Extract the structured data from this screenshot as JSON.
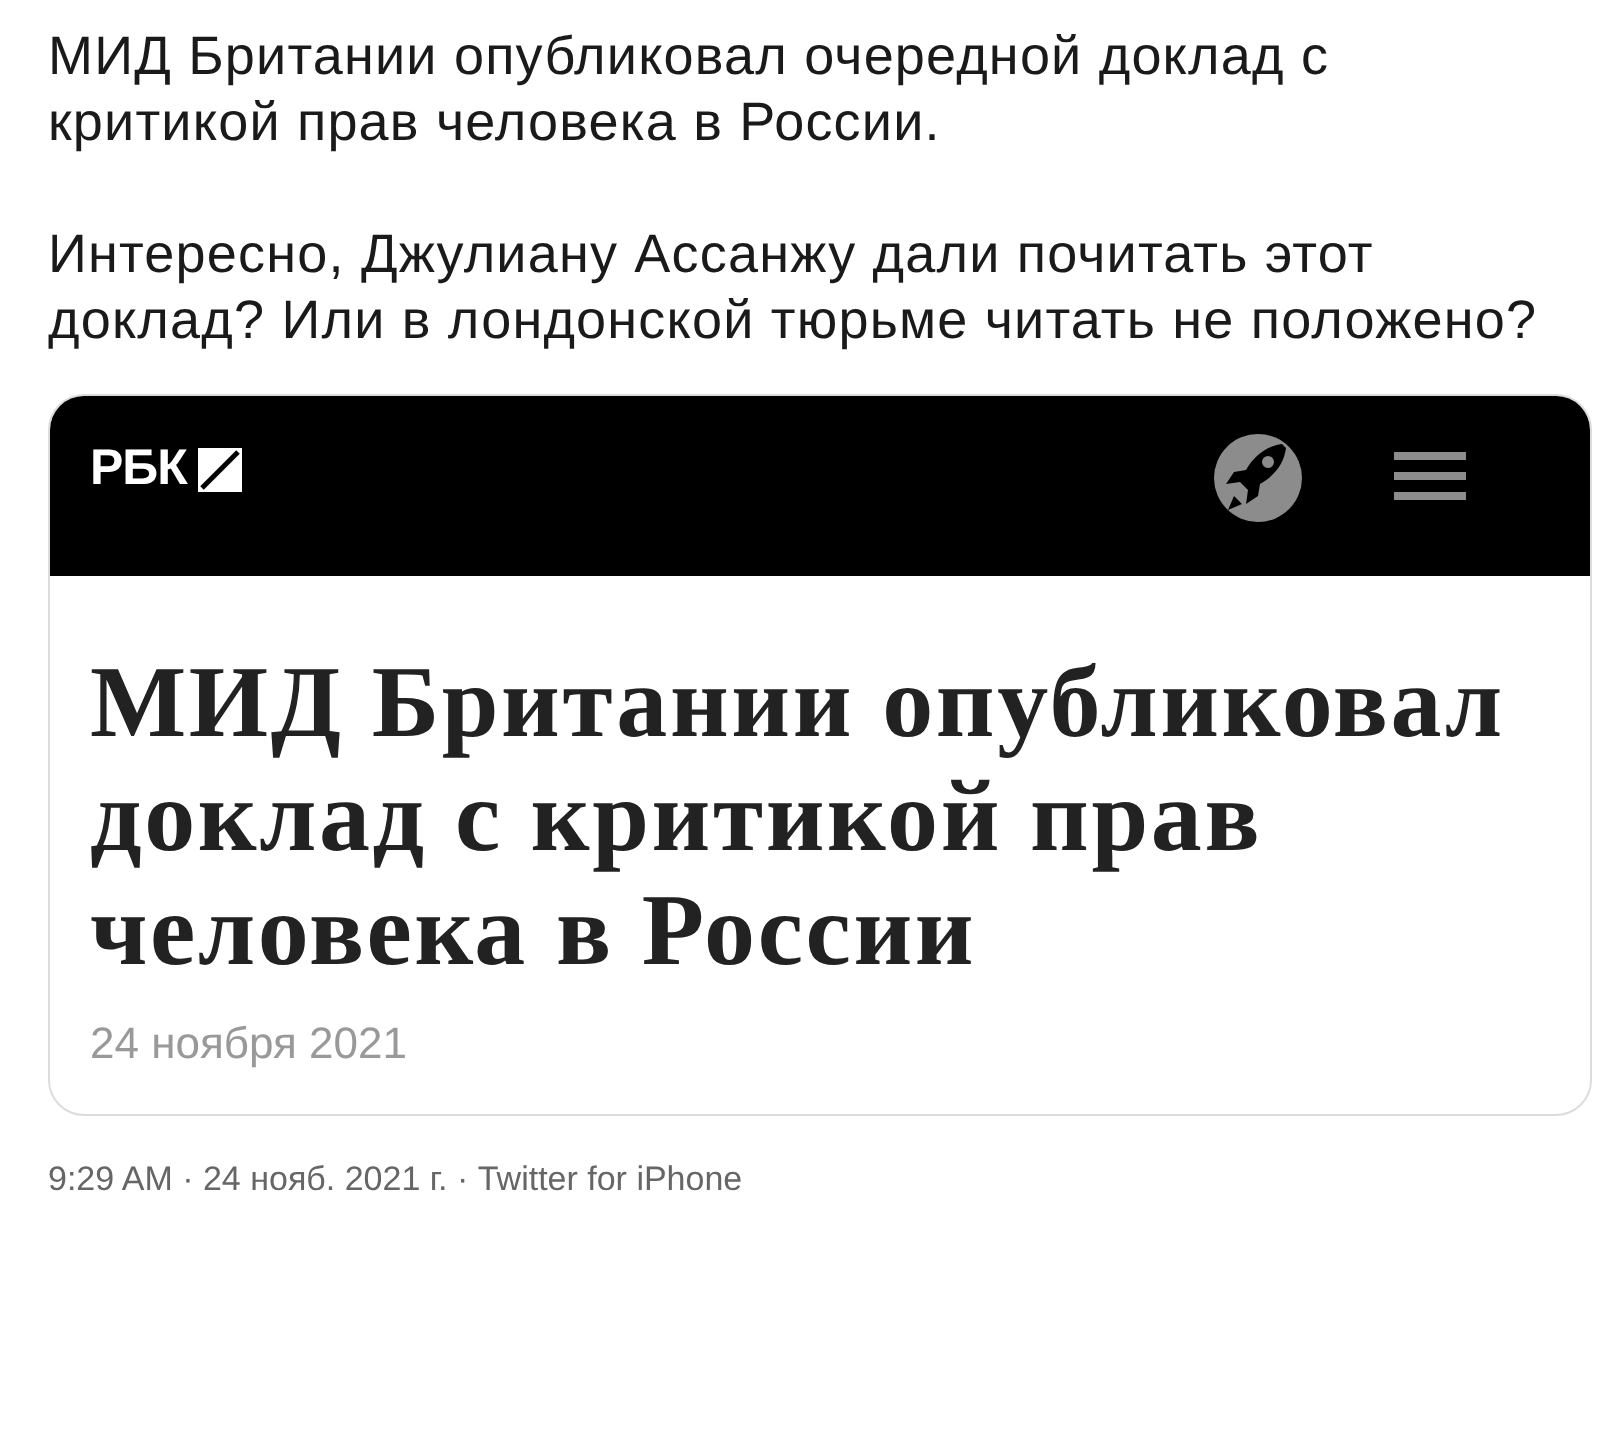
{
  "tweet": {
    "paragraphs": [
      "МИД Британии опубликовал очередной доклад с критикой прав человека в России.",
      "Интересно, Джулиану Ассанжу дали почитать этот доклад? Или в лондонской тюрьме читать не положено?"
    ]
  },
  "card": {
    "logo": "РБК",
    "headline": "МИД Британии опубликовал доклад с критикой прав человека в России",
    "date": "24 ноября 2021"
  },
  "meta": {
    "line": "9:29 AM · 24 нояб. 2021 г. · Twitter for iPhone"
  }
}
